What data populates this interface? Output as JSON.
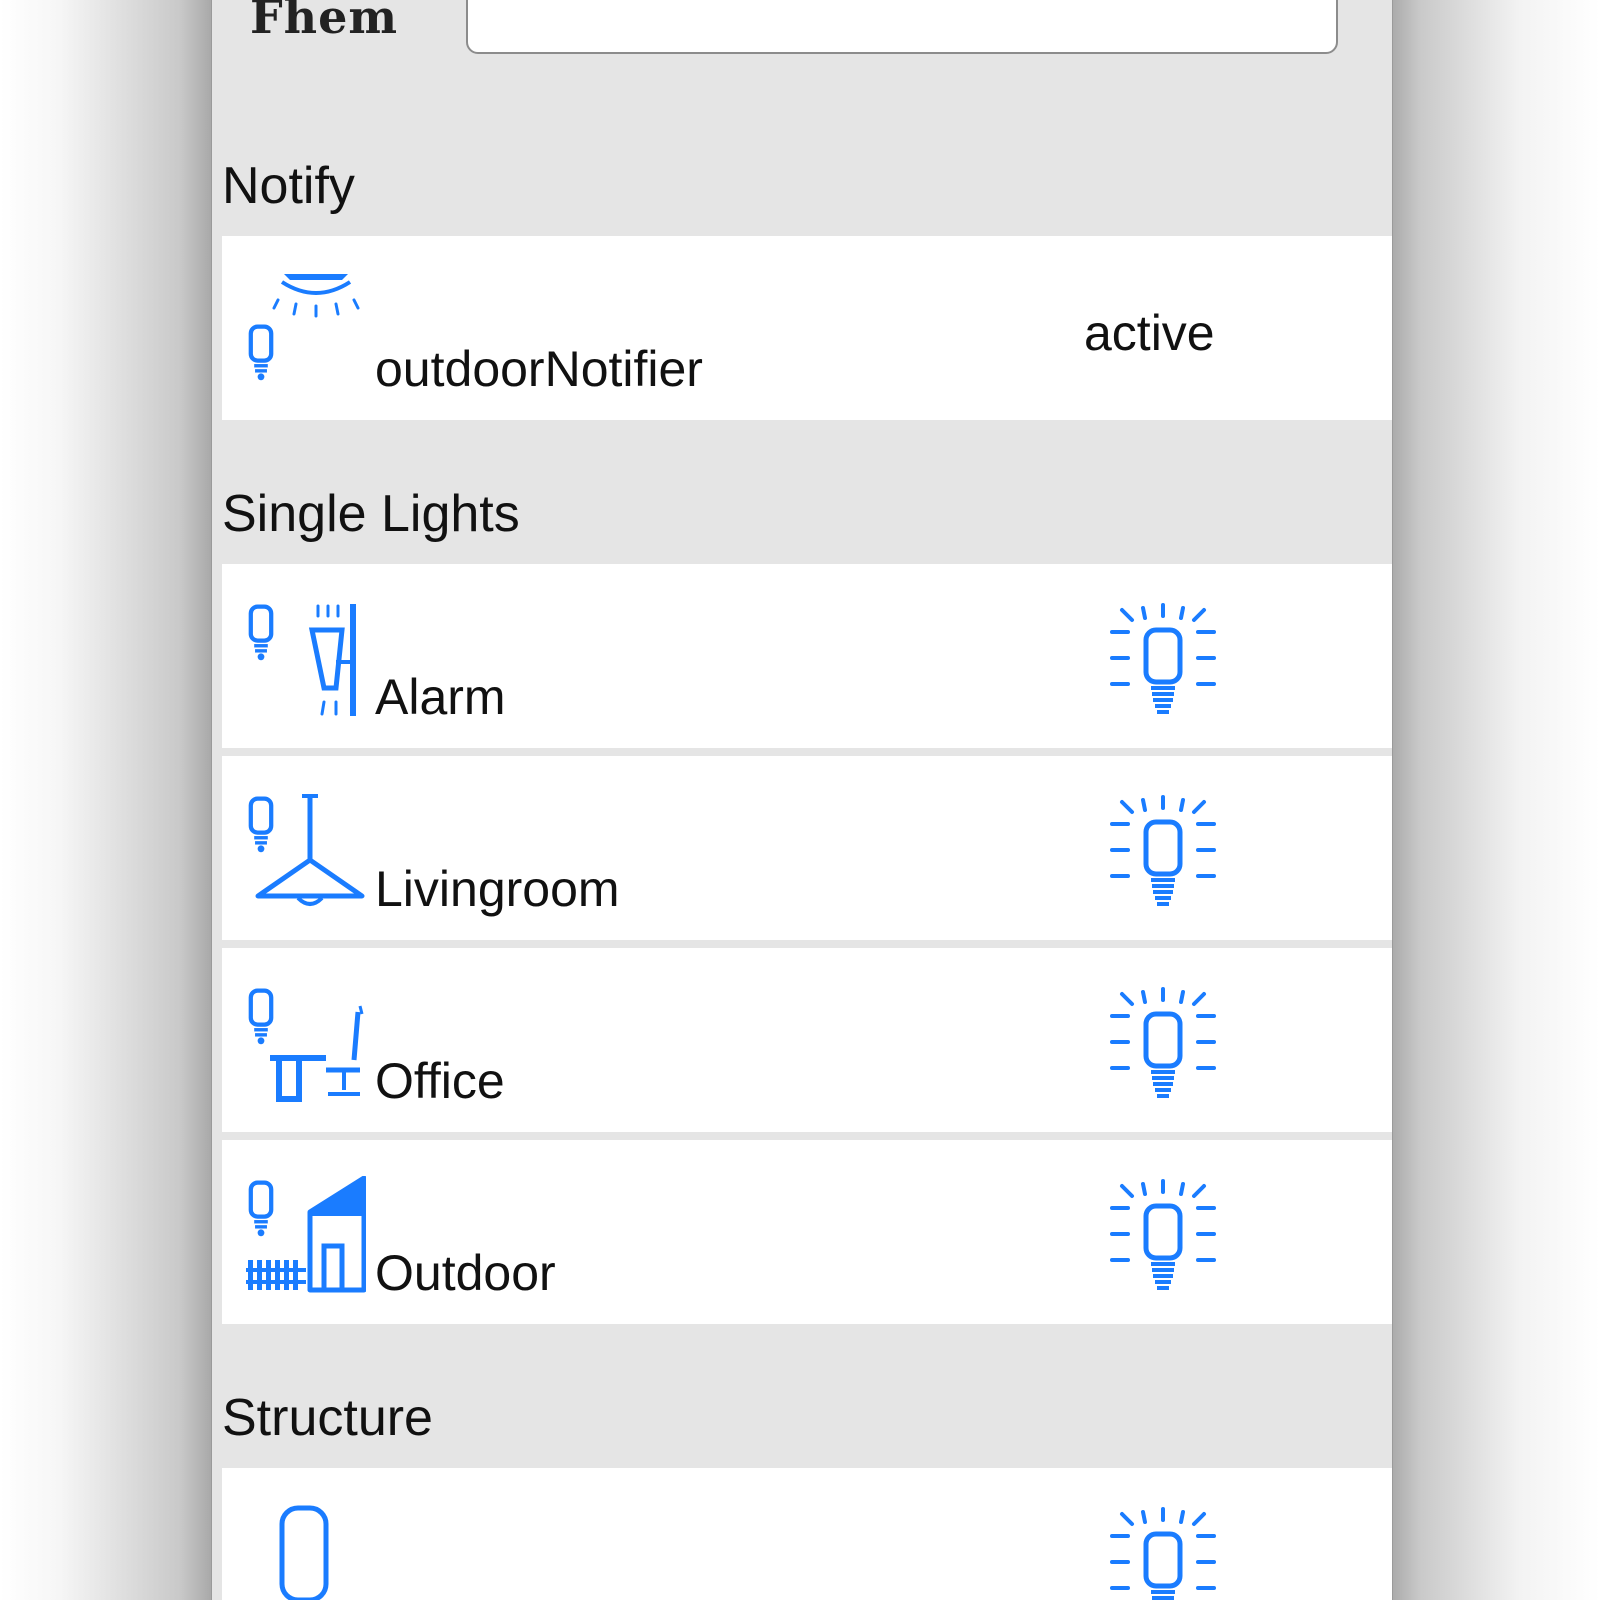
{
  "header": {
    "logo_text": "Fhem",
    "search_value": ""
  },
  "groups": {
    "notify": {
      "title": "Notify",
      "items": [
        {
          "name": "outdoorNotifier",
          "state": "active",
          "icon": "ceiling-lamp-icon"
        }
      ]
    },
    "single_lights": {
      "title": "Single Lights",
      "items": [
        {
          "name": "Alarm",
          "state_icon": "light-bulb-on-icon",
          "icon": "wall-lamp-icon"
        },
        {
          "name": "Livingroom",
          "state_icon": "light-bulb-on-icon",
          "icon": "pendant-lamp-icon"
        },
        {
          "name": "Office",
          "state_icon": "light-bulb-on-icon",
          "icon": "desk-chair-icon"
        },
        {
          "name": "Outdoor",
          "state_icon": "light-bulb-on-icon",
          "icon": "house-fence-icon"
        }
      ]
    },
    "structure": {
      "title": "Structure",
      "items": [
        {
          "name": "",
          "state_icon": "light-bulb-on-icon",
          "icon": "bulb-outline-icon"
        }
      ]
    }
  },
  "colors": {
    "icon_blue": "#1a7cff",
    "panel_bg": "#e5e5e5",
    "row_bg": "#ffffff",
    "text": "#111111"
  }
}
